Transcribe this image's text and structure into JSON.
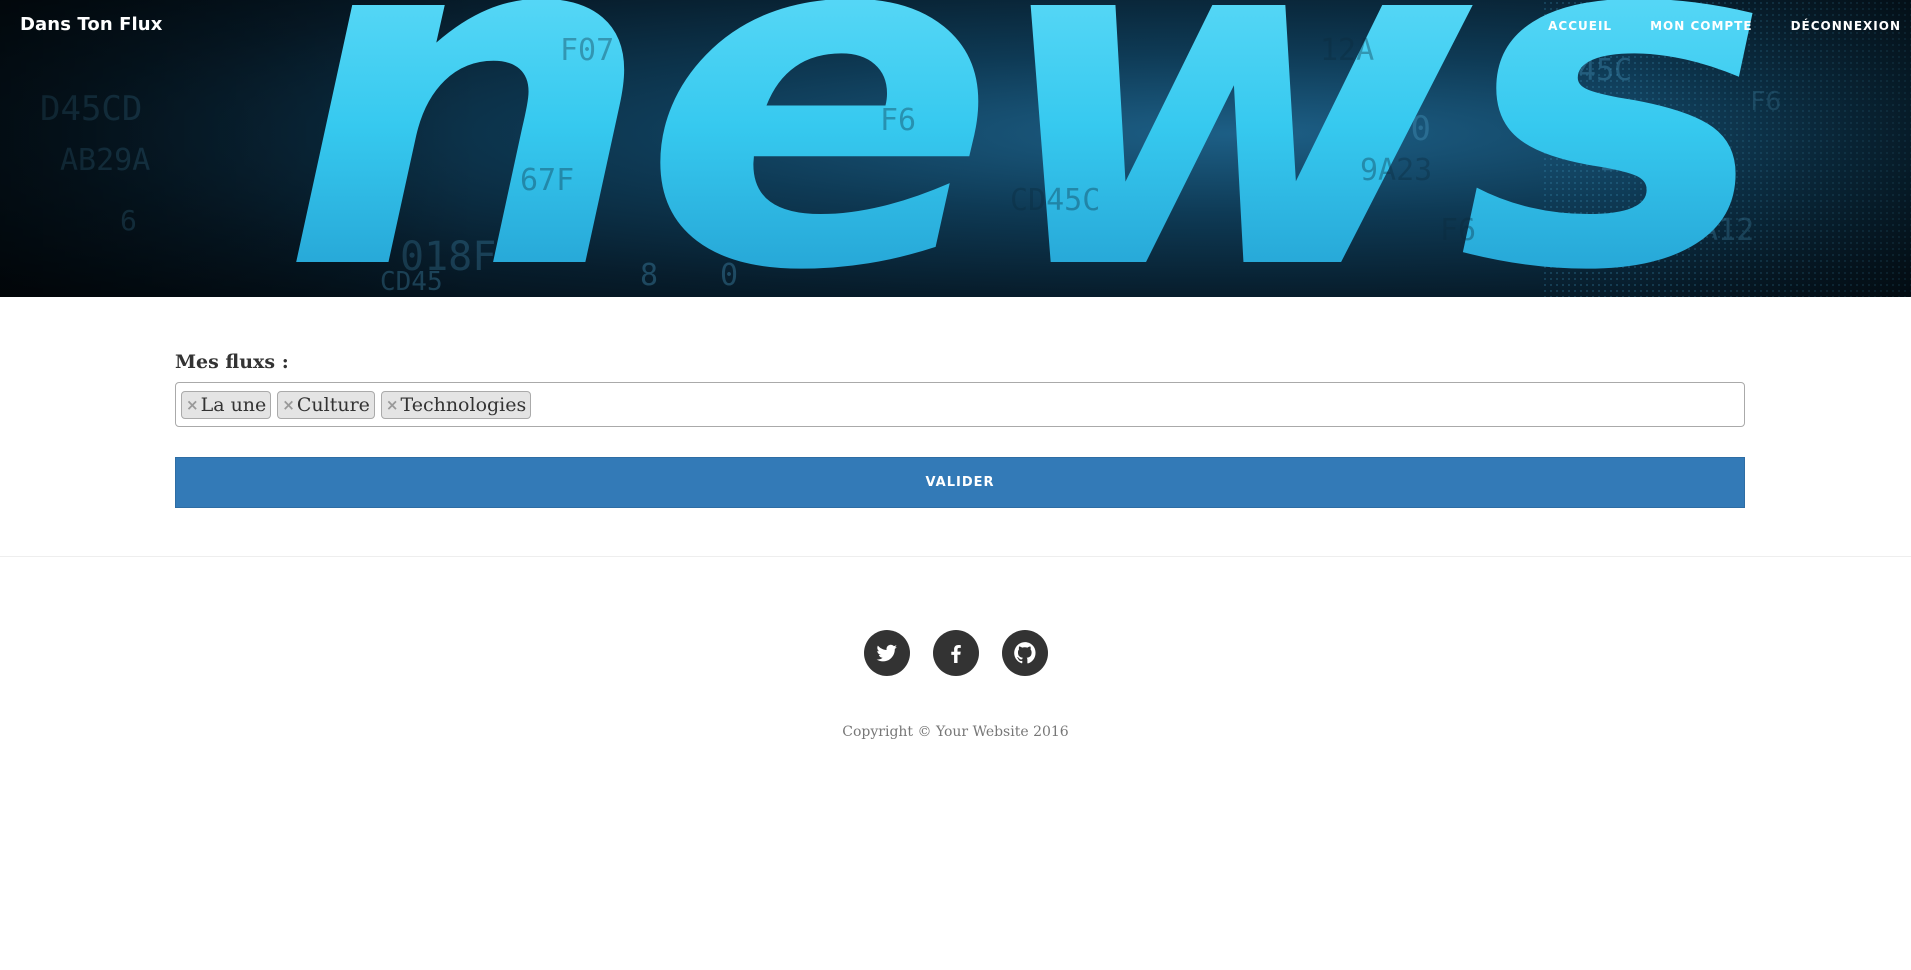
{
  "header": {
    "brand": "Dans Ton Flux",
    "hero_word": "news",
    "nav": [
      {
        "label": "ACCUEIL"
      },
      {
        "label": "MON COMPTE"
      },
      {
        "label": "DÉCONNEXION"
      }
    ]
  },
  "form": {
    "label": "Mes fluxs :",
    "tags": [
      {
        "remove": "×",
        "label": "La une"
      },
      {
        "remove": "×",
        "label": "Culture"
      },
      {
        "remove": "×",
        "label": "Technologies"
      }
    ],
    "submit_label": "VALIDER",
    "accent_color": "#337ab7"
  },
  "footer": {
    "social": [
      {
        "icon": "twitter-icon"
      },
      {
        "icon": "facebook-icon"
      },
      {
        "icon": "github-icon"
      }
    ],
    "copyright": "Copyright © Your Website 2016"
  }
}
